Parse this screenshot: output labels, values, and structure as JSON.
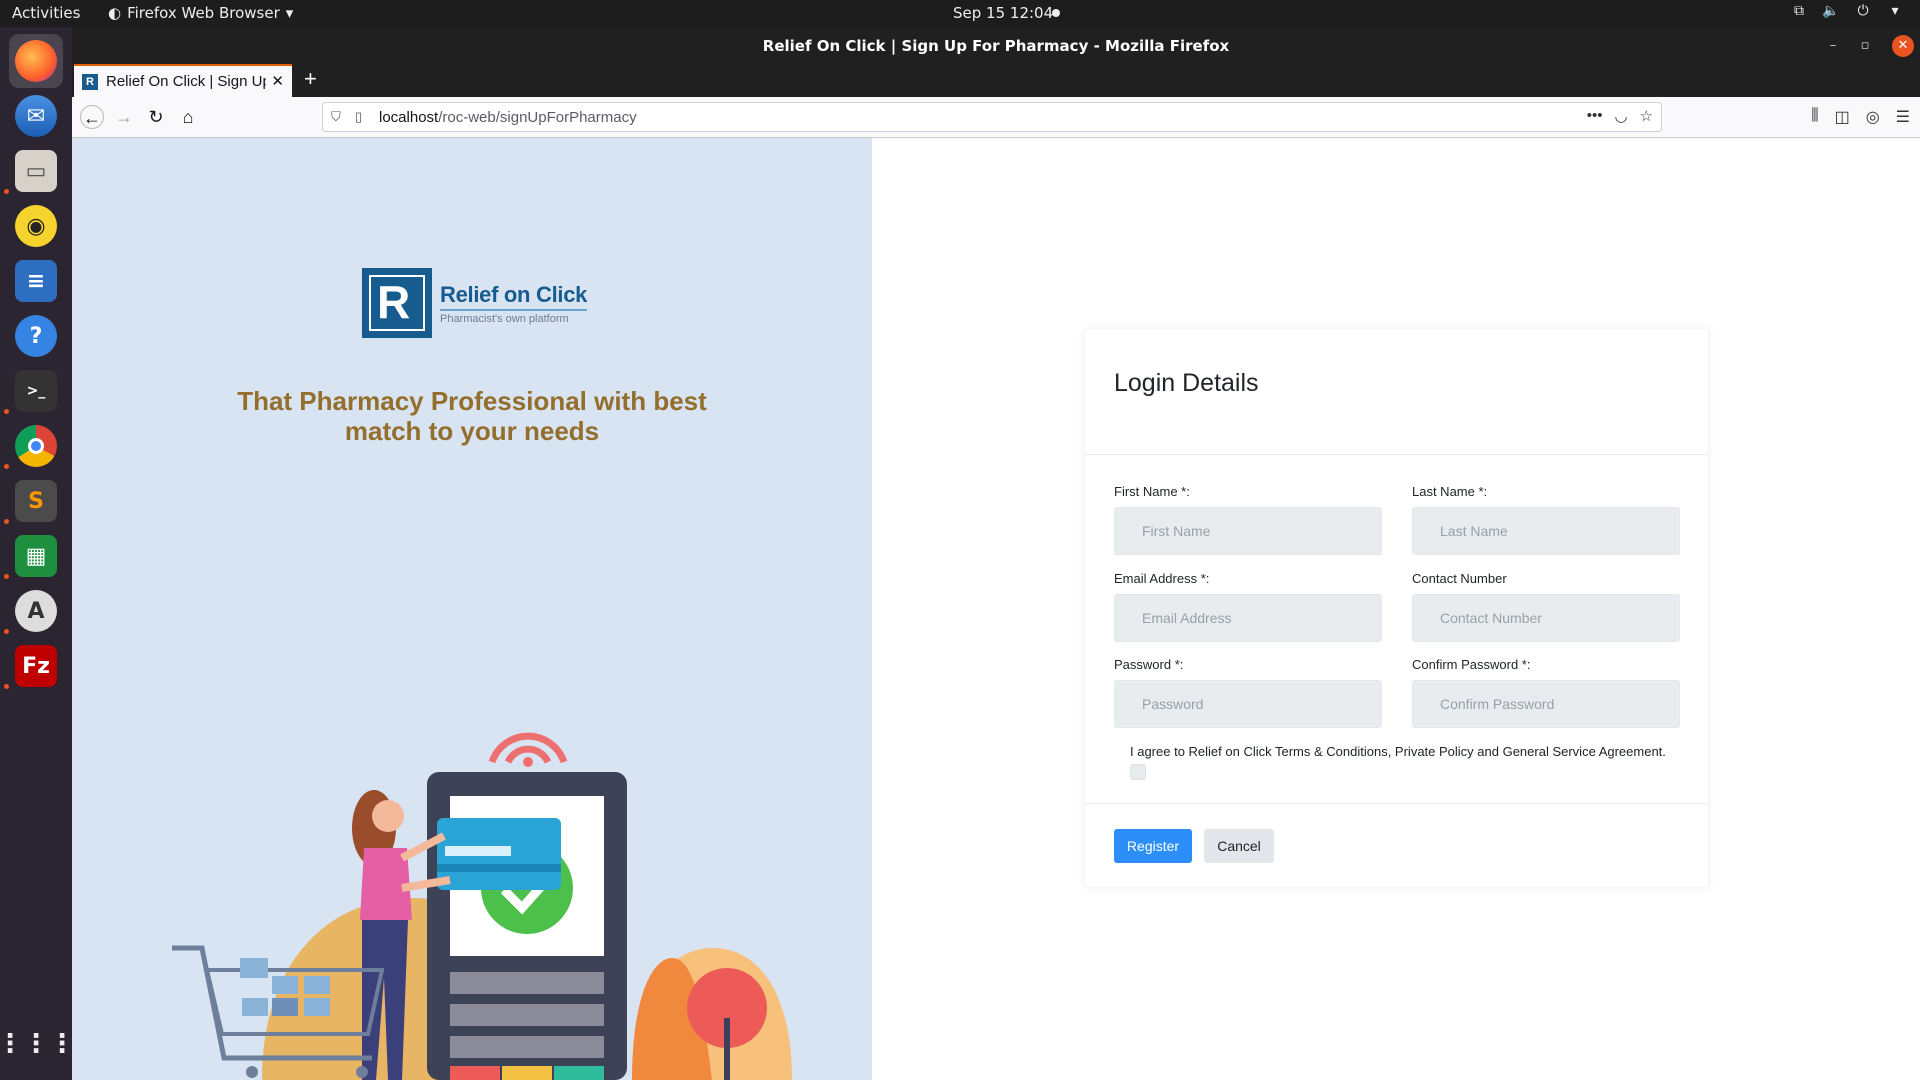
{
  "topbar": {
    "activities": "Activities",
    "app_menu": "Firefox Web Browser",
    "clock": "Sep 15  12:04"
  },
  "window": {
    "title": "Relief On Click | Sign Up For Pharmacy - Mozilla Firefox"
  },
  "tab": {
    "title": "Relief On Click | Sign Up For Pharmacy",
    "favicon_letter": "R"
  },
  "urlbar": {
    "host": "localhost",
    "path": "/roc-web/signUpForPharmacy"
  },
  "brand": {
    "name": "Relief on Click",
    "tagline_small": "Pharmacist's own platform",
    "logo_letter": "R",
    "color": "#175b8f"
  },
  "hero": {
    "tagline": "That Pharmacy Professional with best match to your needs",
    "text_color": "#946e2d"
  },
  "form": {
    "heading": "Login Details",
    "fields": {
      "first_name": {
        "label": "First Name *:",
        "placeholder": "First Name"
      },
      "last_name": {
        "label": "Last Name *:",
        "placeholder": "Last Name"
      },
      "email": {
        "label": "Email Address *:",
        "placeholder": "Email Address"
      },
      "contact": {
        "label": "Contact Number",
        "placeholder": "Contact Number"
      },
      "password": {
        "label": "Password *:",
        "placeholder": "Password"
      },
      "confirm_password": {
        "label": "Confirm Password *:",
        "placeholder": "Confirm Password"
      }
    },
    "agree_text": "I agree to Relief on Click Terms & Conditions, Private Policy and General Service Agreement.",
    "register_label": "Register",
    "cancel_label": "Cancel",
    "accent": "#2c8ef8"
  },
  "dock": {
    "icons": [
      "firefox-icon",
      "thunderbird-icon",
      "files-icon",
      "rhythmbox-icon",
      "writer-icon",
      "help-icon",
      "terminal-icon",
      "chrome-icon",
      "sublime-icon",
      "calc-icon",
      "software-icon",
      "filezilla-icon",
      "apps-grid-icon"
    ]
  }
}
